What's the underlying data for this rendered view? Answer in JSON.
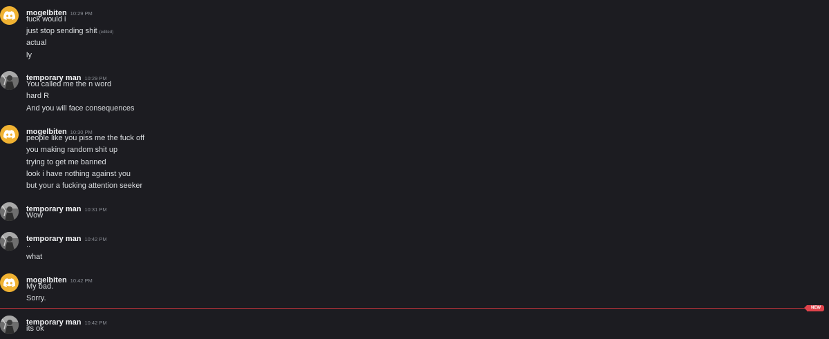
{
  "colors": {
    "background": "#1c1c21",
    "discord_avatar": "#f0b232",
    "new_divider": "#e0434b"
  },
  "badge": {
    "new_label": "NEW"
  },
  "groups": [
    {
      "username": "mogelbiten",
      "timestamp": "10:29 PM",
      "avatar": "discord-logo-icon",
      "messages": [
        "fuck would i",
        "just stop sending shit",
        "actual",
        "ly"
      ],
      "edited_label": "(edited)"
    },
    {
      "username": "temporary man",
      "timestamp": "10:29 PM",
      "avatar": "user-photo",
      "messages": [
        "You called me the n word",
        "hard R",
        "And you will face consequences"
      ]
    },
    {
      "username": "mogelbiten",
      "timestamp": "10:30 PM",
      "avatar": "discord-logo-icon",
      "messages": [
        "people like you piss me the fuck off",
        "you making random shit up",
        "trying to get me banned",
        "look i have nothing against you",
        "but your a fucking attention seeker"
      ]
    },
    {
      "username": "temporary man",
      "timestamp": "10:31 PM",
      "avatar": "user-photo",
      "messages": [
        "Wow"
      ]
    },
    {
      "username": "temporary man",
      "timestamp": "10:42 PM",
      "avatar": "user-photo",
      "messages": [
        "..",
        "what"
      ]
    },
    {
      "username": "mogelbiten",
      "timestamp": "10:42 PM",
      "avatar": "discord-logo-icon",
      "messages": [
        "My bad.",
        "Sorry."
      ]
    },
    {
      "username": "temporary man",
      "timestamp": "10:42 PM",
      "avatar": "user-photo",
      "messages": [
        "its ok"
      ]
    }
  ]
}
